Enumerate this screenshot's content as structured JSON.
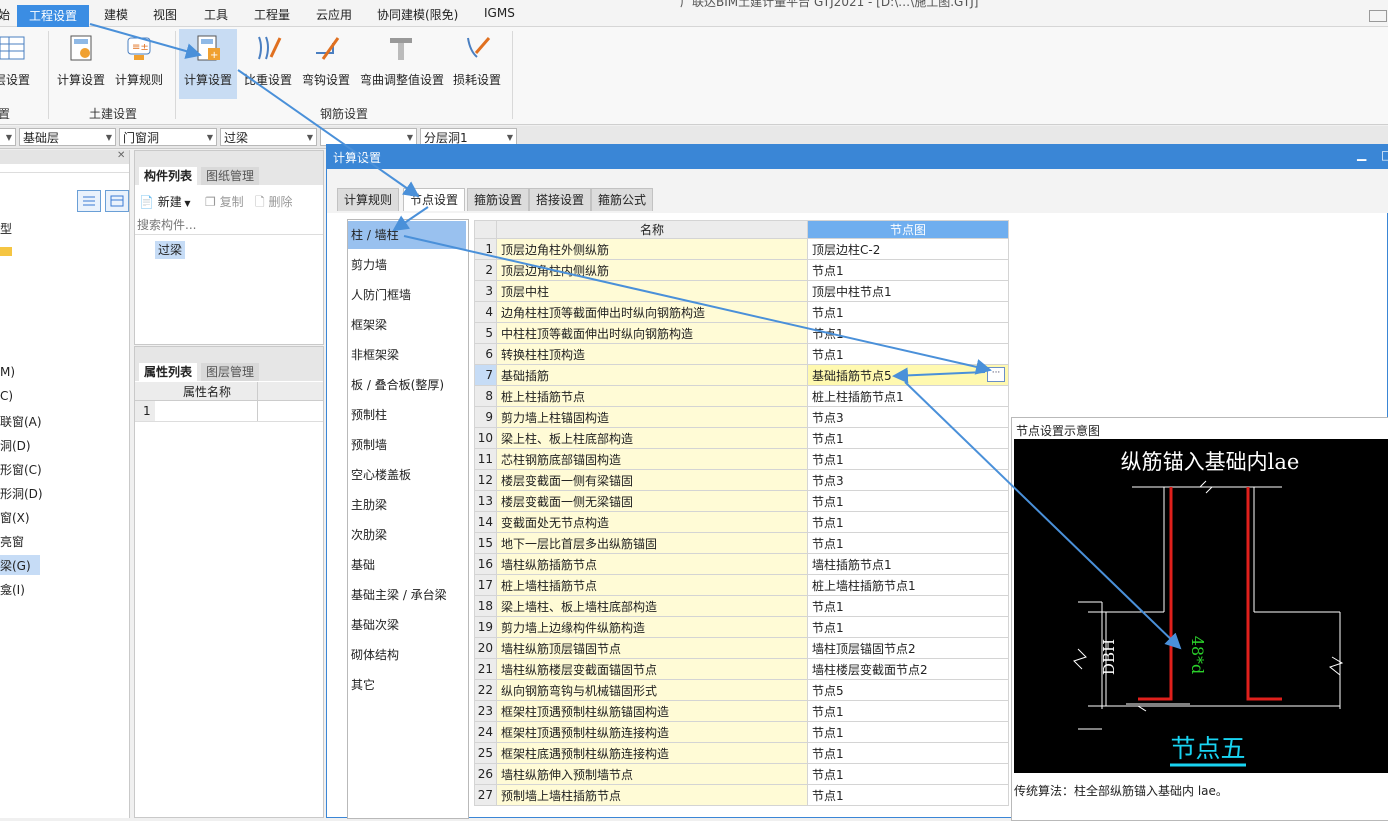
{
  "menu": {
    "items": [
      "始",
      "工程设置",
      "建模",
      "视图",
      "工具",
      "工程量",
      "云应用",
      "协同建模(限免)",
      "IGMS"
    ],
    "active_index": 1,
    "window_title": "广联达BIM土建计量平台 GTJ2021 - [D:\\…\\施工图.GTJ]"
  },
  "ribbon": {
    "buttons": [
      {
        "label": "层设置",
        "icon": "floor-settings-icon"
      },
      {
        "label": "计算设置",
        "icon": "calc-settings-icon"
      },
      {
        "label": "计算规则",
        "icon": "calc-rules-icon"
      },
      {
        "label": "计算设置",
        "icon": "rebar-calc-settings-icon"
      },
      {
        "label": "比重设置",
        "icon": "weight-settings-icon"
      },
      {
        "label": "弯钩设置",
        "icon": "hook-settings-icon"
      },
      {
        "label": "弯曲调整值设置",
        "icon": "bend-adjust-icon"
      },
      {
        "label": "损耗设置",
        "icon": "loss-settings-icon"
      }
    ],
    "groups": [
      "置",
      "土建设置",
      "钢筋设置"
    ]
  },
  "filters": [
    "",
    "基础层",
    "门窗洞",
    "过梁",
    "",
    "分层洞1"
  ],
  "left_nav": {
    "items": [
      "型",
      "",
      "M)",
      "C)",
      "联窗(A)",
      "洞(D)",
      "形窗(C)",
      "形洞(D)",
      "窗(X)",
      "亮窗",
      "梁(G)",
      "龛(I)"
    ],
    "selected_index": 10
  },
  "component_panel": {
    "tabs": [
      "构件列表",
      "图纸管理"
    ],
    "toolbar": [
      "新建",
      "复制",
      "删除"
    ],
    "search_placeholder": "搜索构件...",
    "items": [
      "过梁"
    ]
  },
  "property_panel": {
    "tabs": [
      "属性列表",
      "图层管理"
    ],
    "column_header": "属性名称",
    "rows": [
      "1"
    ]
  },
  "dialog": {
    "title": "计算设置",
    "tabs": [
      "计算规则",
      "节点设置",
      "箍筋设置",
      "搭接设置",
      "箍筋公式"
    ],
    "active_tab": 1,
    "categories": [
      "柱 / 墙柱",
      "剪力墙",
      "人防门框墙",
      "框架梁",
      "非框架梁",
      "板 / 叠合板(整厚)",
      "预制柱",
      "预制墙",
      "空心楼盖板",
      "主肋梁",
      "次肋梁",
      "基础",
      "基础主梁 / 承台梁",
      "基础次梁",
      "砌体结构",
      "其它"
    ],
    "selected_category": 0,
    "grid": {
      "headers": [
        "",
        "名称",
        "节点图"
      ],
      "selected_row": 7,
      "rows": [
        {
          "n": "1",
          "name": "顶层边角柱外侧纵筋",
          "node": "顶层边柱C-2"
        },
        {
          "n": "2",
          "name": "顶层边角柱内侧纵筋",
          "node": "节点1"
        },
        {
          "n": "3",
          "name": "顶层中柱",
          "node": "顶层中柱节点1"
        },
        {
          "n": "4",
          "name": "边角柱柱顶等截面伸出时纵向钢筋构造",
          "node": "节点1"
        },
        {
          "n": "5",
          "name": "中柱柱顶等截面伸出时纵向钢筋构造",
          "node": "节点1"
        },
        {
          "n": "6",
          "name": "转换柱柱顶构造",
          "node": "节点1"
        },
        {
          "n": "7",
          "name": "基础插筋",
          "node": "基础插筋节点5"
        },
        {
          "n": "8",
          "name": "桩上柱插筋节点",
          "node": "桩上柱插筋节点1"
        },
        {
          "n": "9",
          "name": "剪力墙上柱锚固构造",
          "node": "节点3"
        },
        {
          "n": "10",
          "name": "梁上柱、板上柱底部构造",
          "node": "节点1"
        },
        {
          "n": "11",
          "name": "芯柱钢筋底部锚固构造",
          "node": "节点1"
        },
        {
          "n": "12",
          "name": "楼层变截面一侧有梁锚固",
          "node": "节点3"
        },
        {
          "n": "13",
          "name": "楼层变截面一侧无梁锚固",
          "node": "节点1"
        },
        {
          "n": "14",
          "name": "变截面处无节点构造",
          "node": "节点1"
        },
        {
          "n": "15",
          "name": "地下一层比首层多出纵筋锚固",
          "node": "节点1"
        },
        {
          "n": "16",
          "name": "墙柱纵筋插筋节点",
          "node": "墙柱插筋节点1"
        },
        {
          "n": "17",
          "name": "桩上墙柱插筋节点",
          "node": "桩上墙柱插筋节点1"
        },
        {
          "n": "18",
          "name": "梁上墙柱、板上墙柱底部构造",
          "node": "节点1"
        },
        {
          "n": "19",
          "name": "剪力墙上边缘构件纵筋构造",
          "node": "节点1"
        },
        {
          "n": "20",
          "name": "墙柱纵筋顶层锚固节点",
          "node": "墙柱顶层锚固节点2"
        },
        {
          "n": "21",
          "name": "墙柱纵筋楼层变截面锚固节点",
          "node": "墙柱楼层变截面节点2"
        },
        {
          "n": "22",
          "name": "纵向钢筋弯钩与机械锚固形式",
          "node": "节点5"
        },
        {
          "n": "23",
          "name": "框架柱顶遇预制柱纵筋锚固构造",
          "node": "节点1"
        },
        {
          "n": "24",
          "name": "框架柱顶遇预制柱纵筋连接构造",
          "node": "节点1"
        },
        {
          "n": "25",
          "name": "框架柱底遇预制柱纵筋连接构造",
          "node": "节点1"
        },
        {
          "n": "26",
          "name": "墙柱纵筋伸入预制墙节点",
          "node": "节点1"
        },
        {
          "n": "27",
          "name": "预制墙上墙柱插筋节点",
          "node": "节点1"
        }
      ]
    },
    "diagram": {
      "panel_title": "节点设置示意图",
      "heading": "纵筋锚入基础内lae",
      "dim_dbh": "DBH",
      "dim_48d": "48*d",
      "node_label": "节点五",
      "caption": "传统算法：柱全部纵筋锚入基础内 lae。"
    }
  },
  "colors": {
    "accent": "#3a86d6",
    "arrow": "#4a90d9",
    "grid_header_highlight": "#6faeef",
    "name_cell": "#fffbd6",
    "rebar_red": "#e0201c",
    "dim_green": "#2bd12b",
    "label_cyan": "#19d4f2"
  }
}
